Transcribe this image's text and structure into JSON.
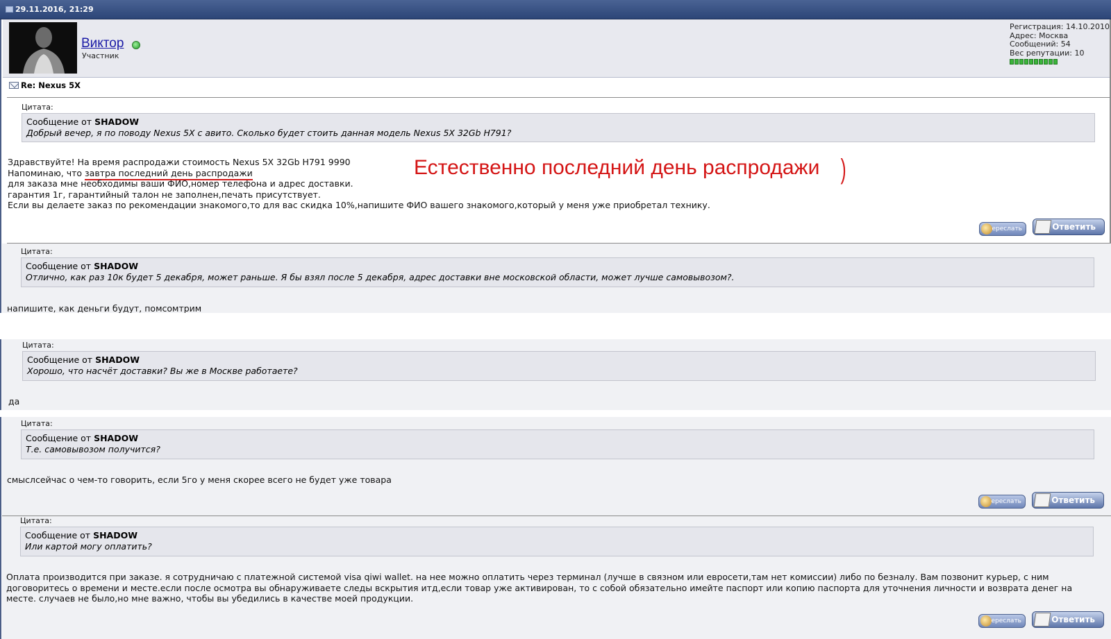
{
  "post": {
    "date": "29.11.2016, 21:29",
    "subject": "Re: Nexus 5X"
  },
  "user": {
    "name": "Виктор",
    "role": "Участник",
    "registration": "Регистрация: 14.10.2010",
    "address": "Адрес: Москва",
    "messages": "Сообщений: 54",
    "reputation": "Вес репутации: 10",
    "reputation_blocks": 10
  },
  "quote_label": "Цитата:",
  "quote_prefix": "Сообщение от",
  "quote_author": "SHADOW",
  "messages": [
    {
      "quote": "Добрый вечер, я по поводу Nexus 5X с авито. Сколько будет стоить данная модель Nexus 5X 32Gb H791?",
      "reply_lines": [
        "Здравствуйте! На время распродажи стоимость Nexus 5X 32Gb H791 9990",
        "Напоминаю, что ",
        "завтра последний день распродажи",
        "для заказа мне необходимы ваши ФИО,номер телефона и адрес доставки.",
        "гарантия 1г, гарантийный талон не заполнен,печать присутствует.",
        "Если вы делаете заказ по рекомендации знакомого,то для вас скидка 10%,напишите ФИО вашего знакомого,который у меня уже приобретал технику."
      ]
    },
    {
      "quote": "Отлично, как раз 10к будет 5 декабря, может раньше. Я бы взял после 5 декабря, адрес доставки вне московской области, может лучше самовывозом?.",
      "reply": "напишите, как деньги будут, помсомтрим"
    },
    {
      "quote": "Хорошо, что насчёт доставки? Вы же в Москве работаете?",
      "reply": "да"
    },
    {
      "quote": "Т.е. самовывозом получится?",
      "reply": "смыслсейчас о чем-то говорить, если 5го у меня скорее всего не будет уже товара"
    },
    {
      "quote": "Или картой могу оплатить?",
      "reply_lines": [
        "Оплата производится при заказе. я сотрудничаю с платежной системой visa qiwi wallet. на нее можно оплатить через терминал (лучше в связном или евросети,там нет комиссии) либо по безналу. Вам позвонит курьер, с ним",
        "договоритесь о времени и месте.если после осмотра вы обнаруживаете следы вскрытия итд,если товар уже активирован, то с собой обязательно имейте паспорт или копию паспорта для уточнения личности и возврата денег на",
        "месте. случаев не было,но мне важно, чтобы вы убедились в качестве моей продукции."
      ]
    }
  ],
  "annotation": "Естественно последний день распродажи",
  "annotation_paren": ")",
  "buttons": {
    "forward": "Переслать",
    "reply": "Ответить"
  }
}
